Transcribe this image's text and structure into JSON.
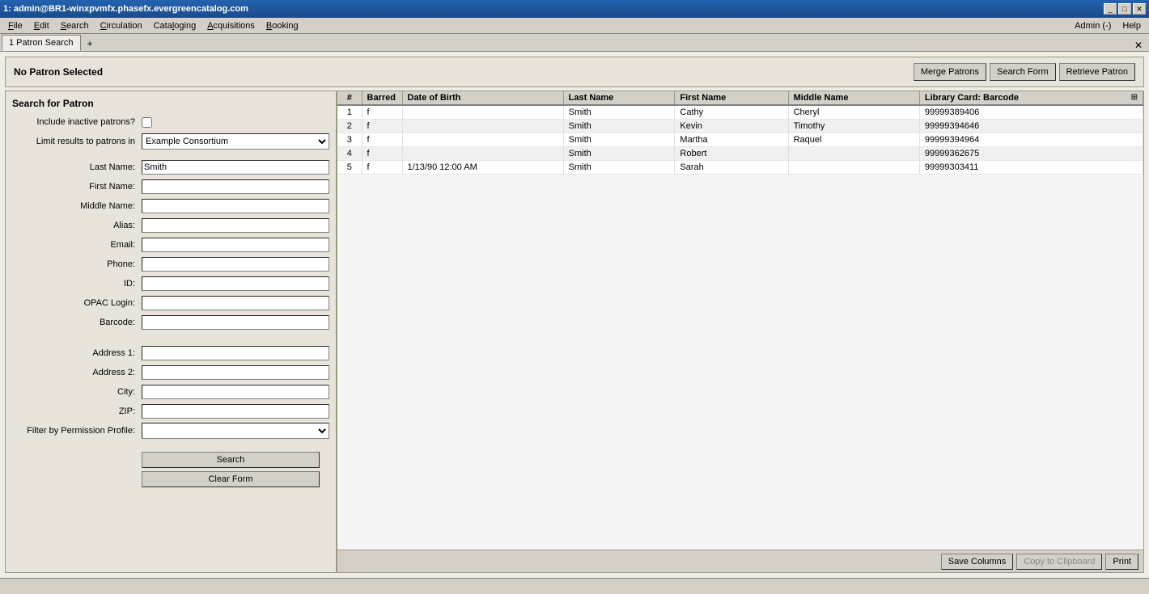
{
  "titleBar": {
    "title": "1: admin@BR1-winxpvmfx.phasefx.evergreencatalog.com",
    "minimizeLabel": "_",
    "maximizeLabel": "□",
    "closeLabel": "✕"
  },
  "menuBar": {
    "items": [
      {
        "id": "file",
        "label": "File",
        "underlineIndex": 0
      },
      {
        "id": "edit",
        "label": "Edit",
        "underlineIndex": 0
      },
      {
        "id": "search",
        "label": "Search",
        "underlineIndex": 0
      },
      {
        "id": "circulation",
        "label": "Circulation",
        "underlineIndex": 0
      },
      {
        "id": "cataloging",
        "label": "Cataloging",
        "underlineIndex": 0
      },
      {
        "id": "acquisitions",
        "label": "Acquisitions",
        "underlineIndex": 0
      },
      {
        "id": "booking",
        "label": "Booking",
        "underlineIndex": 0
      }
    ],
    "adminLabel": "Admin (-)",
    "helpLabel": "Help"
  },
  "tabBar": {
    "tabs": [
      {
        "id": "patron-search",
        "label": "1 Patron Search",
        "active": true,
        "closeable": false
      }
    ],
    "addTabLabel": "+"
  },
  "topBanner": {
    "noPatronLabel": "No Patron Selected",
    "buttons": {
      "mergePatrons": "Merge Patrons",
      "searchForm": "Search Form",
      "retrievePatron": "Retrieve Patron"
    }
  },
  "searchForm": {
    "title": "Search for Patron",
    "fields": {
      "includeInactive": {
        "label": "Include inactive patrons?",
        "checked": false
      },
      "limitResultsLabel": "Limit results to patrons in",
      "limitResultsValue": "Example Consortium",
      "limitResultsOptions": [
        "Example Consortium"
      ],
      "lastName": {
        "label": "Last Name:",
        "value": "Smith"
      },
      "firstName": {
        "label": "First Name:",
        "value": ""
      },
      "middleName": {
        "label": "Middle Name:",
        "value": ""
      },
      "alias": {
        "label": "Alias:",
        "value": ""
      },
      "email": {
        "label": "Email:",
        "value": ""
      },
      "phone": {
        "label": "Phone:",
        "value": ""
      },
      "id": {
        "label": "ID:",
        "value": ""
      },
      "opacLogin": {
        "label": "OPAC Login:",
        "value": ""
      },
      "barcode": {
        "label": "Barcode:",
        "value": ""
      },
      "address1": {
        "label": "Address 1:",
        "value": ""
      },
      "address2": {
        "label": "Address 2:",
        "value": ""
      },
      "city": {
        "label": "City:",
        "value": ""
      },
      "zip": {
        "label": "ZIP:",
        "value": ""
      },
      "filterByPermProfile": {
        "label": "Filter by Permission Profile:",
        "value": ""
      }
    },
    "searchButton": "Search",
    "clearFormButton": "Clear Form"
  },
  "resultsTable": {
    "columns": [
      {
        "id": "num",
        "label": "#"
      },
      {
        "id": "barred",
        "label": "Barred"
      },
      {
        "id": "dob",
        "label": "Date of Birth"
      },
      {
        "id": "lastName",
        "label": "Last Name"
      },
      {
        "id": "firstName",
        "label": "First Name"
      },
      {
        "id": "middleName",
        "label": "Middle Name"
      },
      {
        "id": "libraryCard",
        "label": "Library Card: Barcode"
      }
    ],
    "rows": [
      {
        "num": 1,
        "barred": "f",
        "dob": "",
        "lastName": "Smith",
        "firstName": "Cathy",
        "middleName": "Cheryl",
        "libraryCard": "99999389406"
      },
      {
        "num": 2,
        "barred": "f",
        "dob": "",
        "lastName": "Smith",
        "firstName": "Kevin",
        "middleName": "Timothy",
        "libraryCard": "99999394646"
      },
      {
        "num": 3,
        "barred": "f",
        "dob": "",
        "lastName": "Smith",
        "firstName": "Martha",
        "middleName": "Raquel",
        "libraryCard": "99999394964"
      },
      {
        "num": 4,
        "barred": "f",
        "dob": "",
        "lastName": "Smith",
        "firstName": "Robert",
        "middleName": "",
        "libraryCard": "99999362675"
      },
      {
        "num": 5,
        "barred": "f",
        "dob": "1/13/90 12:00 AM",
        "lastName": "Smith",
        "firstName": "Sarah",
        "middleName": "",
        "libraryCard": "99999303411"
      }
    ]
  },
  "resultsFooter": {
    "saveColumns": "Save Columns",
    "copyToClipboard": "Copy to Clipboard",
    "print": "Print"
  },
  "statusBar": {
    "text": ""
  }
}
